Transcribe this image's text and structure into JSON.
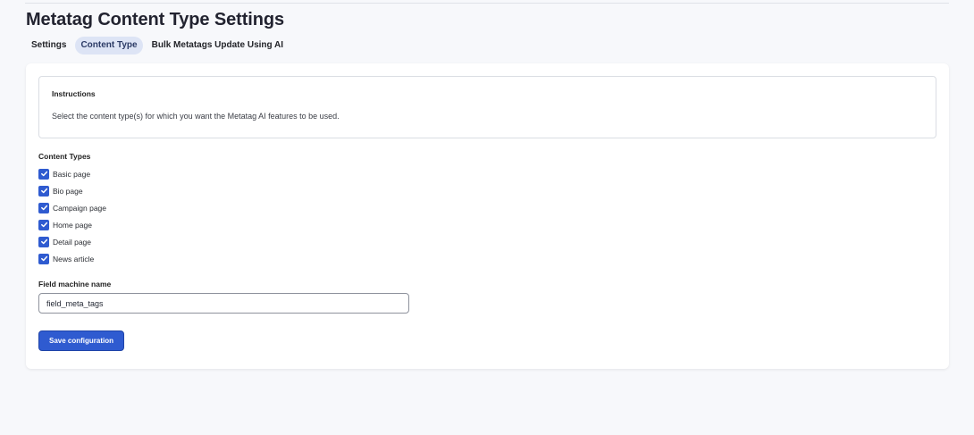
{
  "page": {
    "title": "Metatag Content Type Settings"
  },
  "tabs": [
    {
      "label": "Settings",
      "active": false
    },
    {
      "label": "Content Type",
      "active": true
    },
    {
      "label": "Bulk Metatags Update Using AI",
      "active": false
    }
  ],
  "instructions": {
    "title": "Instructions",
    "text": "Select the content type(s) for which you want the Metatag AI features to be used."
  },
  "content_types": {
    "label": "Content Types",
    "items": [
      {
        "label": "Basic page",
        "checked": true
      },
      {
        "label": "Bio page",
        "checked": true
      },
      {
        "label": "Campaign page",
        "checked": true
      },
      {
        "label": "Home page",
        "checked": true
      },
      {
        "label": "Detail page",
        "checked": true
      },
      {
        "label": "News article",
        "checked": true
      }
    ]
  },
  "field_machine_name": {
    "label": "Field machine name",
    "value": "field_meta_tags"
  },
  "actions": {
    "save_label": "Save configuration"
  },
  "colors": {
    "accent": "#2f5bd0",
    "active_tab_bg": "#dde4f5",
    "page_bg": "#f7f8fb"
  },
  "icons": {
    "checkbox": "checkmark-icon"
  }
}
